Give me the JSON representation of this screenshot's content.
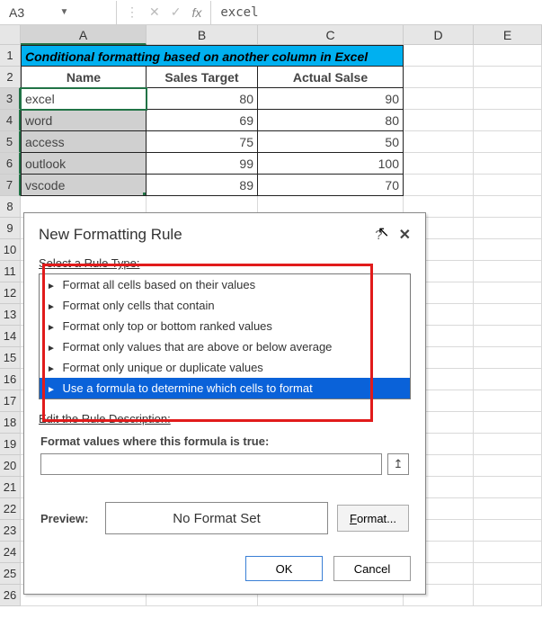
{
  "namebox": "A3",
  "formula_value": "excel",
  "columns": [
    "A",
    "B",
    "C",
    "D",
    "E"
  ],
  "row_numbers": [
    1,
    2,
    3,
    4,
    5,
    6,
    7,
    8,
    9,
    10,
    11,
    12,
    13,
    14,
    15,
    16,
    17,
    18,
    19,
    20,
    21,
    22,
    23,
    24,
    25,
    26
  ],
  "title_cell": "Conditional formatting based on another column in Excel",
  "headers": {
    "a": "Name",
    "b": "Sales Target",
    "c": "Actual Salse"
  },
  "data_rows": [
    {
      "a": "excel",
      "b": "80",
      "c": "90"
    },
    {
      "a": "word",
      "b": "69",
      "c": "80"
    },
    {
      "a": "access",
      "b": "75",
      "c": "50"
    },
    {
      "a": "outlook",
      "b": "99",
      "c": "100"
    },
    {
      "a": "vscode",
      "b": "89",
      "c": "70"
    }
  ],
  "dialog": {
    "title": "New Formatting Rule",
    "select_label": "Select a Rule Type:",
    "options": [
      "Format all cells based on their values",
      "Format only cells that contain",
      "Format only top or bottom ranked values",
      "Format only values that are above or below average",
      "Format only unique or duplicate values",
      "Use a formula to determine which cells to format"
    ],
    "selected_index": 5,
    "edit_label": "Edit the Rule Description:",
    "formula_label": "Format values where this formula is true:",
    "preview_label": "Preview:",
    "preview_text": "No Format Set",
    "format_btn": "Format...",
    "ok": "OK",
    "cancel": "Cancel"
  }
}
